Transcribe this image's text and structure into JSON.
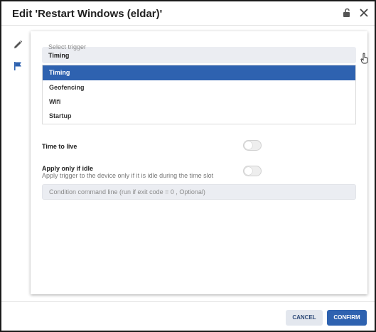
{
  "dialog": {
    "title": "Edit 'Restart Windows (eldar)'"
  },
  "trigger_select": {
    "label": "Select trigger",
    "value": "Timing",
    "options": [
      "Timing",
      "Geofencing",
      "Wifi",
      "Startup"
    ]
  },
  "time_to_live": {
    "label": "Time to live",
    "enabled": false
  },
  "apply_only_if_idle": {
    "label": "Apply only if idle",
    "description": "Apply trigger to the device only if it is idle during the time slot",
    "enabled": false
  },
  "condition": {
    "placeholder": "Condition command line (run if exit code = 0 , Optional)",
    "value": ""
  },
  "footer": {
    "cancel_label": "CANCEL",
    "confirm_label": "CONFIRM"
  },
  "colors": {
    "accent": "#2e62b0",
    "input_bg": "#ebedf2"
  },
  "icons": {
    "lock": "unlocked-padlock-icon",
    "close": "close-icon",
    "edit": "pencil-icon",
    "flag": "flag-icon"
  }
}
